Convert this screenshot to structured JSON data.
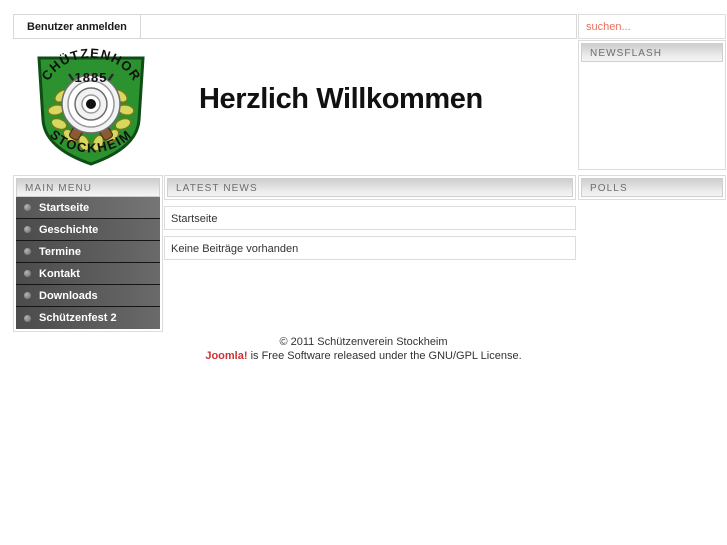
{
  "topbar": {
    "login_tab_label": "Benutzer anmelden"
  },
  "search": {
    "placeholder": "suchen...",
    "value": "",
    "color": "#e8705f"
  },
  "banner": {
    "title": "Herzlich Willkommen",
    "logo_alt": "Schützenhort Stockheim 1885",
    "logo_text_top": "SCHÜTZENHORT",
    "logo_year": "1885",
    "logo_text_bottom": "STOCKHEIM",
    "logo_color": "#2c9230"
  },
  "right_column": {
    "newsflash_title": "NEWSFLASH",
    "newsflash_body": "",
    "polls_title": "POLLS",
    "polls_body": ""
  },
  "main_menu": {
    "title": "MAIN MENU",
    "items": [
      {
        "label": "Startseite",
        "active": true
      },
      {
        "label": "Geschichte",
        "active": false
      },
      {
        "label": "Termine",
        "active": false
      },
      {
        "label": "Kontakt",
        "active": false
      },
      {
        "label": "Downloads",
        "active": false
      },
      {
        "label": "Schützenfest 2",
        "active": false
      }
    ]
  },
  "content": {
    "title": "LATEST NEWS",
    "page_heading": "Startseite",
    "empty_message": "Keine Beiträge vorhanden"
  },
  "footer": {
    "copyright": "© 2011 Schützenverein Stockheim",
    "joomla_label": "Joomla!",
    "license_text": " is Free Software released under the GNU/GPL License.",
    "joomla_color": "#cc3333"
  }
}
